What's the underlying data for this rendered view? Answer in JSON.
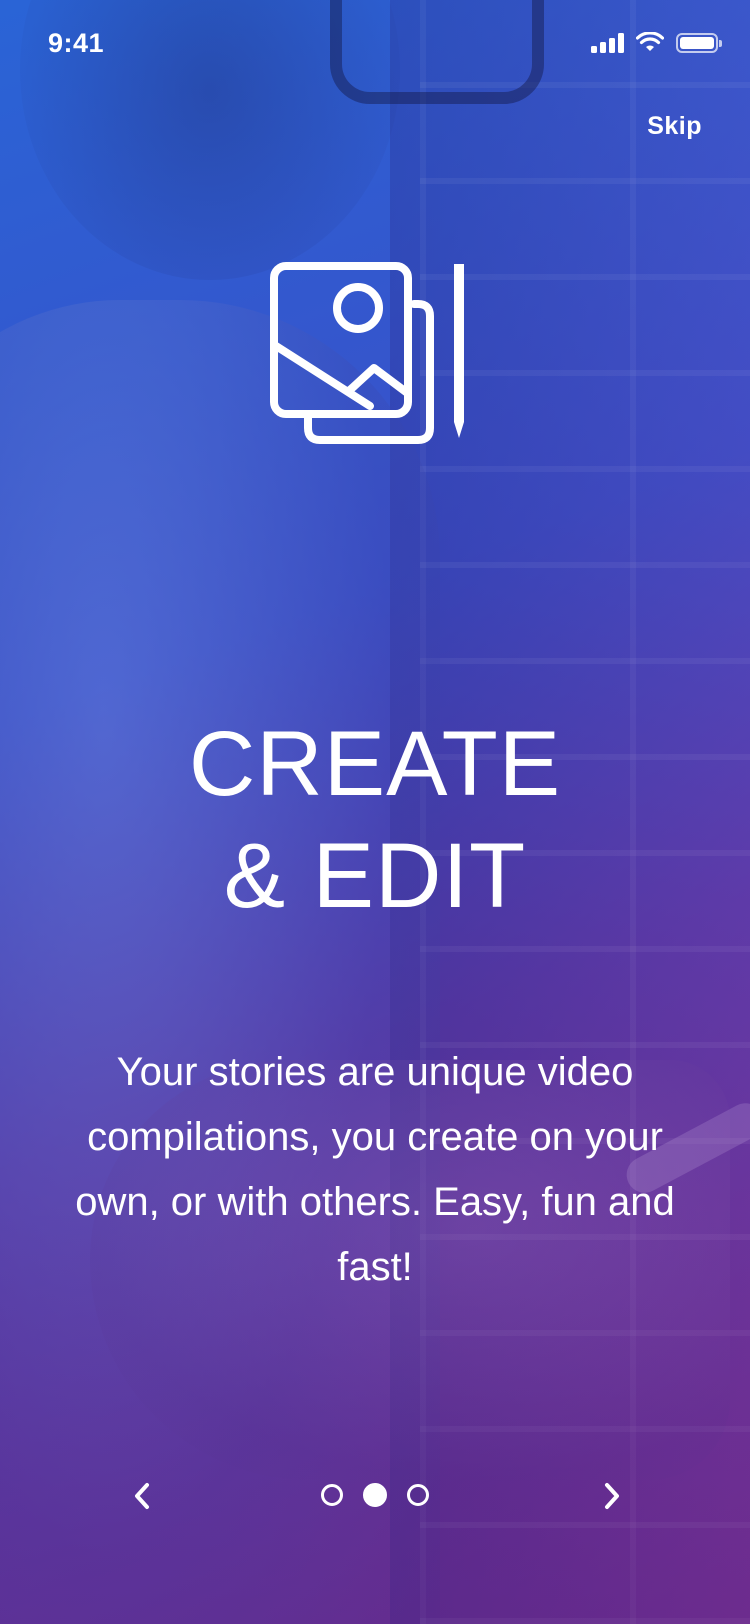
{
  "status_bar": {
    "time": "9:41",
    "icons": [
      "cellular-signal-icon",
      "wifi-icon",
      "battery-icon"
    ]
  },
  "header": {
    "skip_label": "Skip"
  },
  "hero": {
    "icon": "photo-gallery-edit-icon"
  },
  "content": {
    "title_line1": "CREATE",
    "title_line2": "& EDIT",
    "description": "Your stories are unique video compilations, you create on your own, or with others. Easy, fun and fast!"
  },
  "pager": {
    "page_count": 3,
    "active_index": 1,
    "prev_icon": "chevron-left-icon",
    "next_icon": "chevron-right-icon"
  },
  "colors": {
    "gradient_start": "#2a64d6",
    "gradient_end": "#7a2a86",
    "text": "#ffffff"
  }
}
